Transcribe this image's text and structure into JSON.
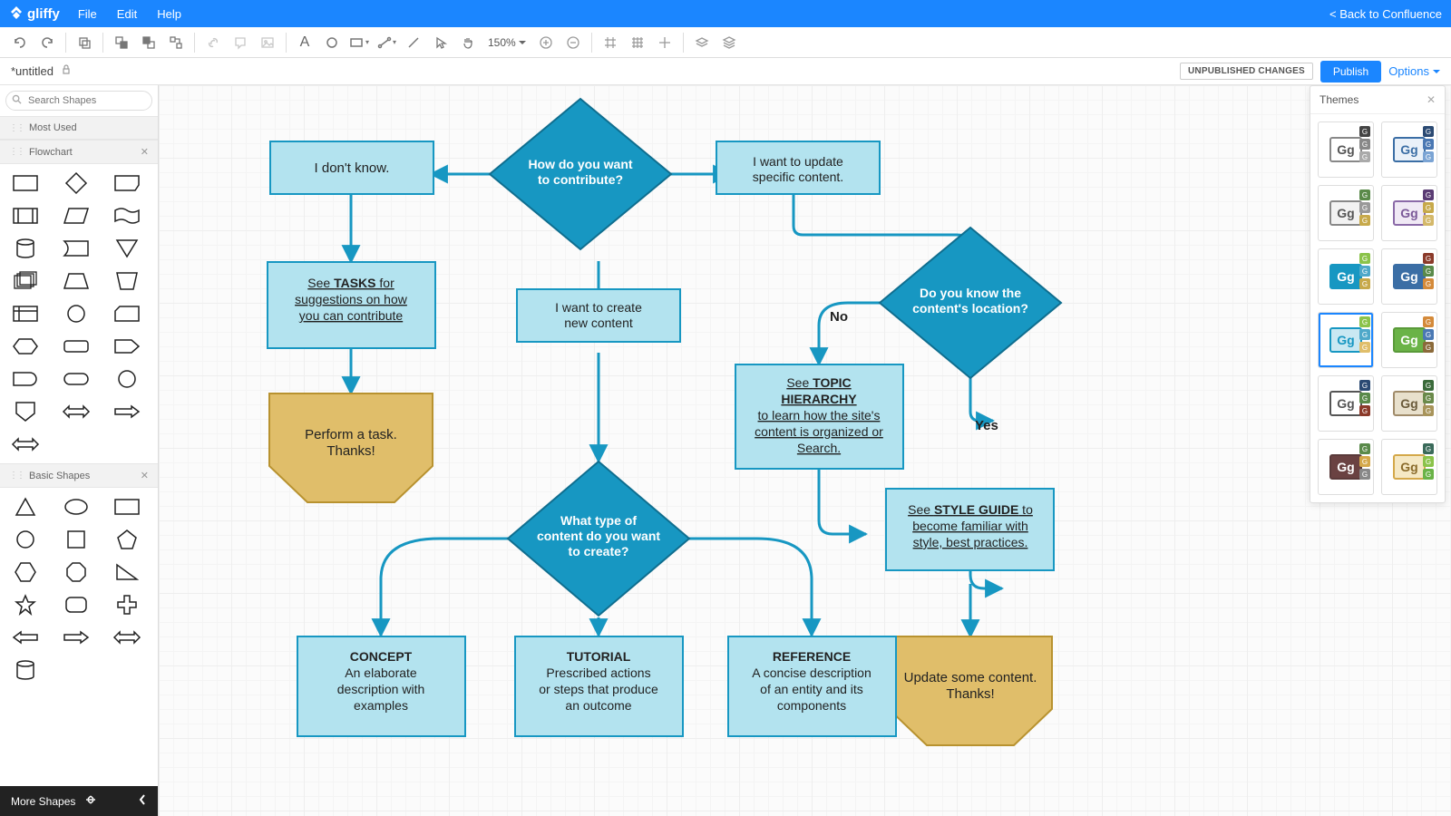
{
  "app": {
    "name": "gliffy"
  },
  "menu": {
    "file": "File",
    "edit": "Edit",
    "help": "Help",
    "back": "< Back to Confluence"
  },
  "toolbar": {
    "zoom": "150%"
  },
  "doc": {
    "title": "*untitled",
    "unpublished": "UNPUBLISHED CHANGES",
    "publish": "Publish",
    "options": "Options"
  },
  "sidebar": {
    "search_placeholder": "Search Shapes",
    "most_used": "Most Used",
    "flowchart": "Flowchart",
    "basic_shapes": "Basic Shapes",
    "more_shapes": "More Shapes"
  },
  "themes": {
    "title": "Themes"
  },
  "flow": {
    "start": "How do you want to contribute?",
    "dont_know": "I don't know.",
    "update": "I want to update specific content.",
    "tasks_link": "See TASKS for suggestions on how you can contribute",
    "create_new": "I want to create new content",
    "perform": "Perform a task. Thanks!",
    "know_location": "Do you know the content's location?",
    "no_label": "No",
    "yes_label": "Yes",
    "topic_hierarchy": "See TOPIC HIERARCHY to learn how the site's content is organized or Search.",
    "style_guide": "See STYLE GUIDE to become familiar with style, best practices.",
    "update_content": "Update some content. Thanks!",
    "content_type": "What type of content do you want to create?",
    "concept_title": "CONCEPT",
    "concept_body": "An elaborate description with examples",
    "tutorial_title": "TUTORIAL",
    "tutorial_body": "Prescribed actions or steps that produce an outcome",
    "reference_title": "REFERENCE",
    "reference_body": "A concise description of an entity and its components"
  }
}
